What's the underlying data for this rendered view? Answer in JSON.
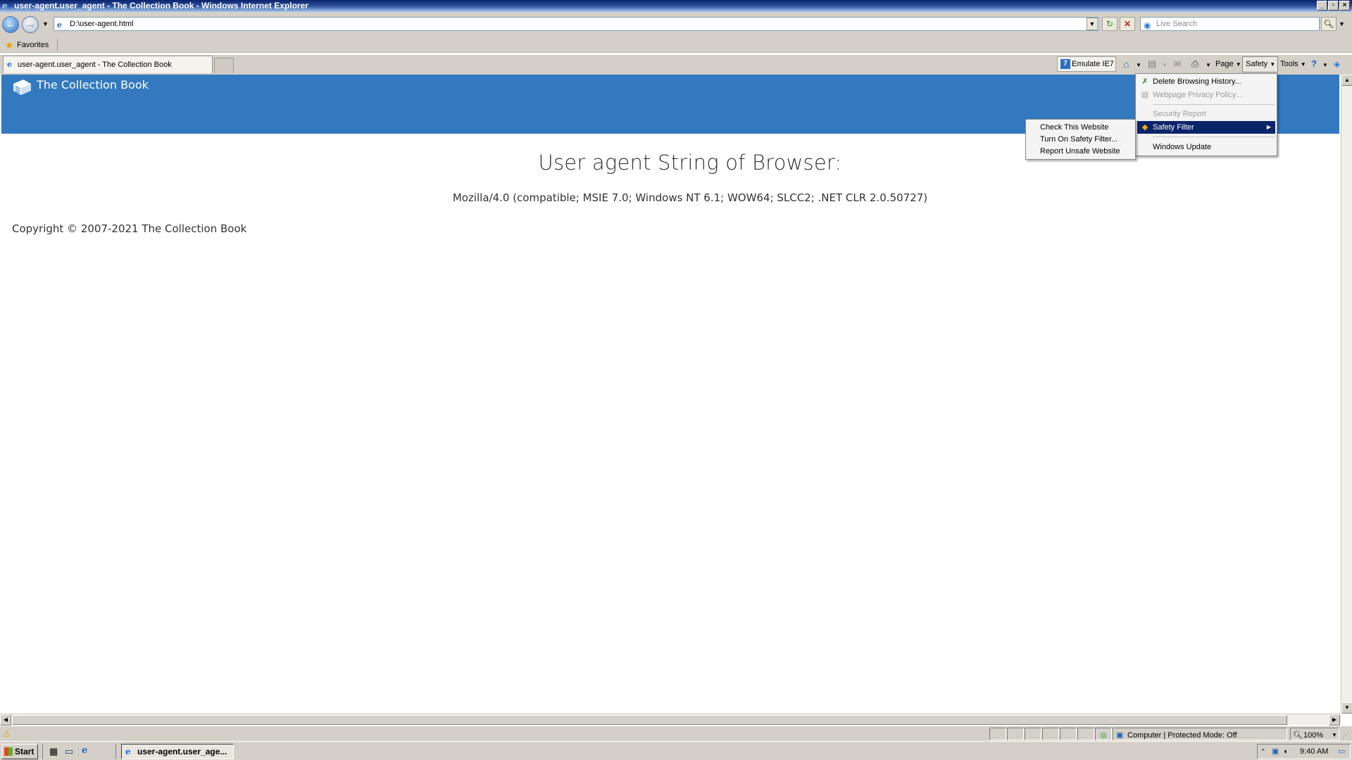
{
  "window": {
    "title": "user-agent.user_agent - The Collection Book - Windows Internet Explorer",
    "controls": [
      "0",
      "1",
      "r"
    ]
  },
  "address_bar": {
    "url": "D:\\user-agent.html",
    "search_placeholder": "Live Search"
  },
  "favorites_bar": {
    "favorites_label": "Favorites"
  },
  "tabs": [
    {
      "label": "user-agent.user_agent - The Collection Book",
      "active": true
    }
  ],
  "command_bar": {
    "emulate_label": "Emulate IE7",
    "emulate_badge": "7",
    "page_label": "Page",
    "safety_label": "Safety",
    "tools_label": "Tools"
  },
  "page": {
    "brand": "The Collection Book",
    "heading": "User agent String of Browser:",
    "user_agent": "Mozilla/4.0 (compatible; MSIE 7.0; Windows NT 6.1; WOW64; SLCC2; .NET CLR 2.0.50727)",
    "copyright": "Copyright © 2007-2021 The Collection Book"
  },
  "safety_menu": {
    "items": [
      {
        "label": "Delete Browsing History...",
        "enabled": true
      },
      {
        "label": "Webpage Privacy Policy...",
        "enabled": false
      },
      {
        "label": "Security Report",
        "enabled": false
      },
      {
        "label": "Safety Filter",
        "enabled": true,
        "highlighted": true,
        "has_submenu": true
      },
      {
        "label": "Windows Update",
        "enabled": true
      }
    ]
  },
  "safety_filter_submenu": {
    "items": [
      {
        "label": "Check This Website"
      },
      {
        "label": "Turn On Safety Filter..."
      },
      {
        "label": "Report Unsafe Website"
      }
    ]
  },
  "status_bar": {
    "zone_text": "Computer | Protected Mode: Off",
    "zoom": "100%"
  },
  "taskbar": {
    "start_label": "Start",
    "task_label": "user-agent.user_age...",
    "clock": "9:40 AM"
  },
  "colors": {
    "banner": "#3279c0",
    "menu_highlight": "#0a246a",
    "chrome": "#d4d0c8"
  }
}
